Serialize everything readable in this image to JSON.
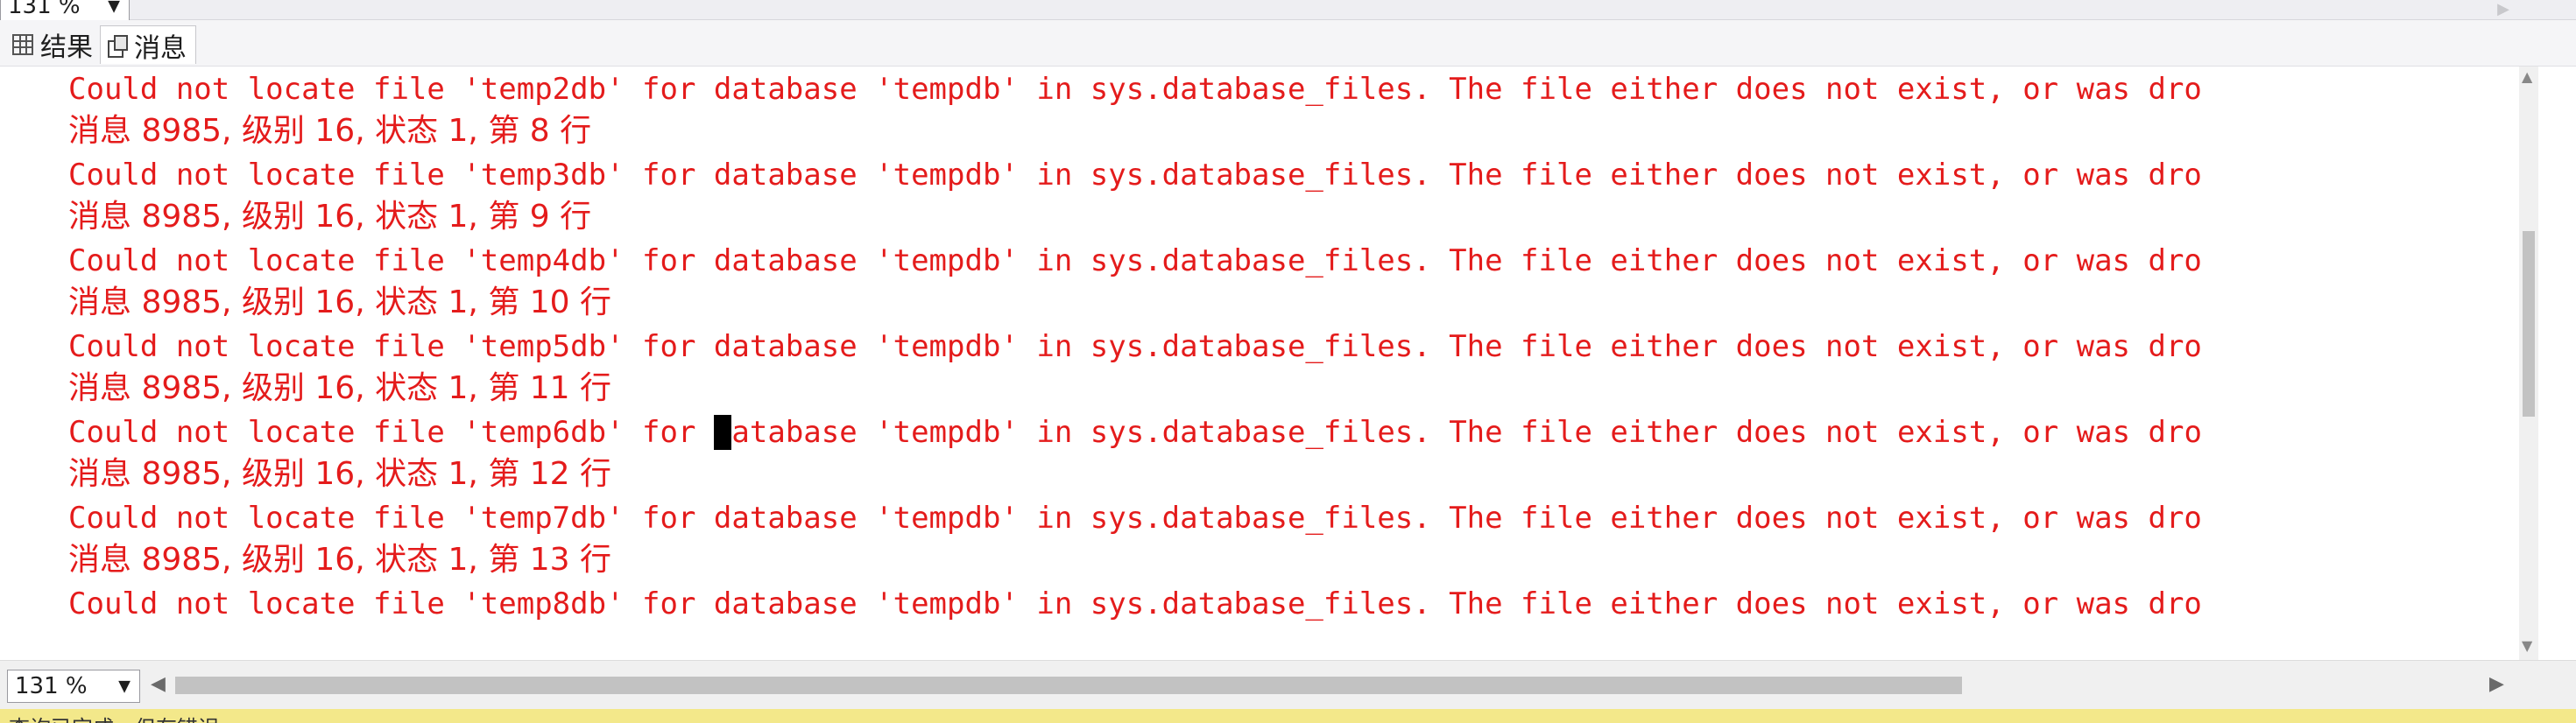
{
  "zoom_top": "131 %",
  "tabs": [
    {
      "label": "结果"
    },
    {
      "label": "消息"
    }
  ],
  "messages": [
    {
      "text": "Could not locate file 'temp2db' for database 'tempdb' in sys.database_files. The file either does not exist, or was dro"
    },
    {
      "text": "消息 8985, 级别 16, 状态 1, 第 8 行"
    },
    {
      "text": "Could not locate file 'temp3db' for database 'tempdb' in sys.database_files. The file either does not exist, or was dro"
    },
    {
      "text": "消息 8985, 级别 16, 状态 1, 第 9 行"
    },
    {
      "text": "Could not locate file 'temp4db' for database 'tempdb' in sys.database_files. The file either does not exist, or was dro"
    },
    {
      "text": "消息 8985, 级别 16, 状态 1, 第 10 行"
    },
    {
      "text": "Could not locate file 'temp5db' for database 'tempdb' in sys.database_files. The file either does not exist, or was dro"
    },
    {
      "text": "消息 8985, 级别 16, 状态 1, 第 11 行"
    },
    {
      "text_before": "Could not locate file 'temp6db' for ",
      "caret_char": "d",
      "text_after": "atabase 'tempdb' in sys.database_files. The file either does not exist, or was dro"
    },
    {
      "text": "消息 8985, 级别 16, 状态 1, 第 12 行"
    },
    {
      "text": "Could not locate file 'temp7db' for database 'tempdb' in sys.database_files. The file either does not exist, or was dro"
    },
    {
      "text": "消息 8985, 级别 16, 状态 1, 第 13 行"
    },
    {
      "text": "Could not locate file 'temp8db' for database 'tempdb' in sys.database_files. The file either does not exist, or was dro"
    }
  ],
  "zoom_bottom": "131 %",
  "status": {
    "left": "查询已完成，但有错误。"
  },
  "colors": {
    "message_text": "#e41b1b",
    "status_bar": "#f3e88a"
  }
}
